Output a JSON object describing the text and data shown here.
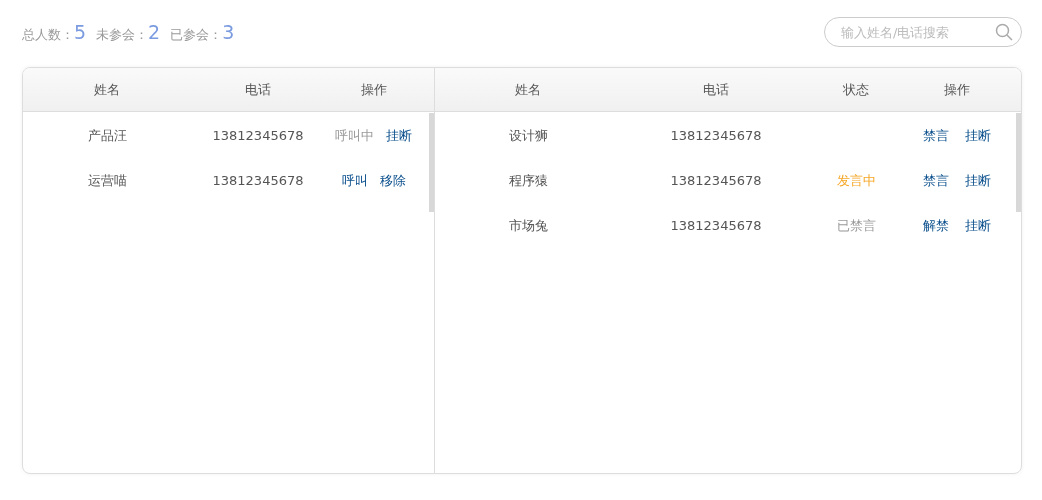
{
  "stats": [
    {
      "label": "总人数：",
      "value": "5"
    },
    {
      "label": "未参会：",
      "value": "2"
    },
    {
      "label": "已参会：",
      "value": "3"
    }
  ],
  "search": {
    "placeholder": "输入姓名/电话搜索"
  },
  "waiting_table": {
    "columns": [
      "姓名",
      "电话",
      "操作"
    ],
    "rows": [
      {
        "name": "产品汪",
        "phone": "13812345678",
        "actions": [
          {
            "label": "呼叫中",
            "disabled": true
          },
          {
            "label": "挂断",
            "disabled": false
          }
        ]
      },
      {
        "name": "运营喵",
        "phone": "13812345678",
        "actions": [
          {
            "label": "呼叫",
            "disabled": false
          },
          {
            "label": "移除",
            "disabled": false
          }
        ]
      }
    ]
  },
  "joined_table": {
    "columns": [
      "姓名",
      "电话",
      "状态",
      "操作"
    ],
    "rows": [
      {
        "name": "设计狮",
        "phone": "13812345678",
        "actions": [
          {
            "label": "禁言",
            "disabled": false
          },
          {
            "label": "挂断",
            "disabled": false
          }
        ]
      },
      {
        "name": "程序猿",
        "phone": "13812345678",
        "status": {
          "kind": "speaking",
          "label": "发言中"
        },
        "actions": [
          {
            "label": "禁言",
            "disabled": false
          },
          {
            "label": "挂断",
            "disabled": false
          }
        ]
      },
      {
        "name": "市场兔",
        "phone": "13812345678",
        "status": {
          "kind": "muted",
          "label": "已禁言"
        },
        "actions": [
          {
            "label": "解禁",
            "disabled": false
          },
          {
            "label": "挂断",
            "disabled": false
          }
        ]
      }
    ]
  }
}
